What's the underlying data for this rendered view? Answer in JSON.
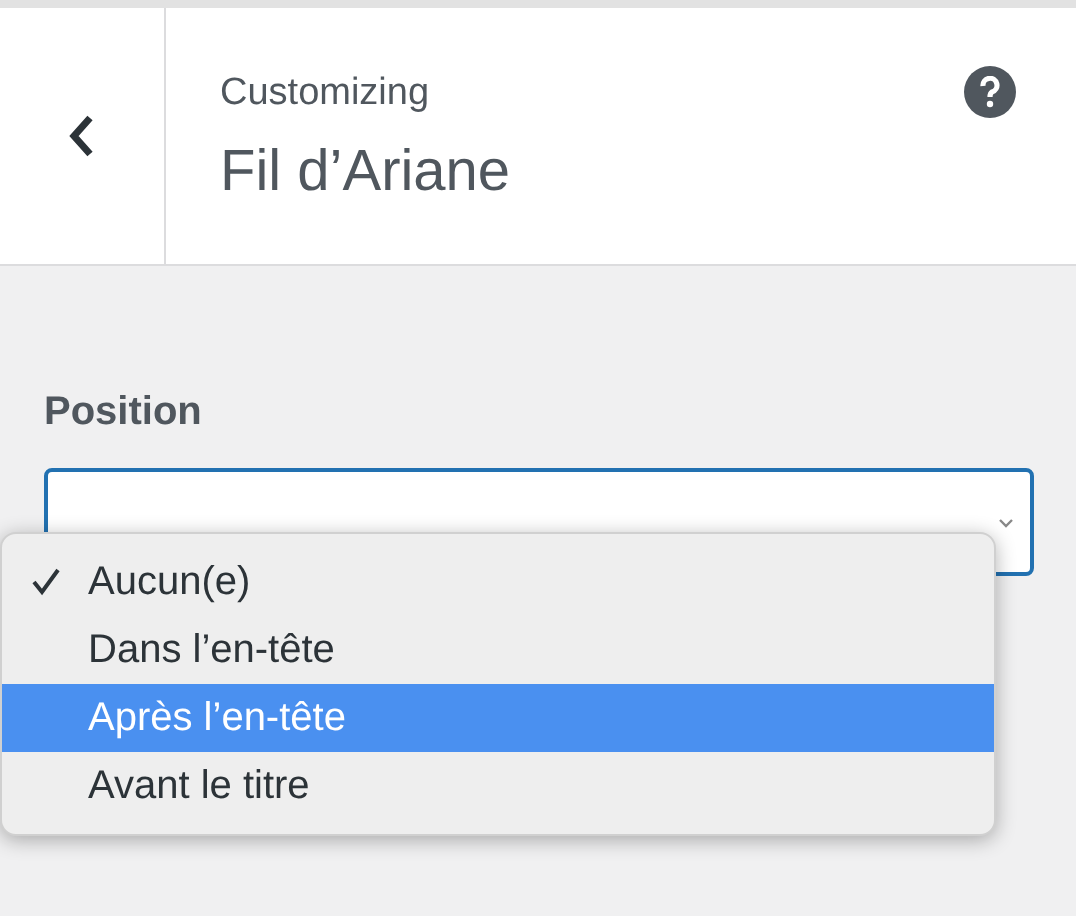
{
  "header": {
    "subtitle": "Customizing",
    "title": "Fil d’Ariane"
  },
  "field": {
    "label": "Position"
  },
  "menu": [
    {
      "label": "Aucun(e)",
      "checked": true,
      "selected": false
    },
    {
      "label": "Dans l’en-tête",
      "checked": false,
      "selected": false
    },
    {
      "label": "Après l’en-tête",
      "checked": false,
      "selected": true
    },
    {
      "label": "Avant le titre",
      "checked": false,
      "selected": false
    }
  ]
}
